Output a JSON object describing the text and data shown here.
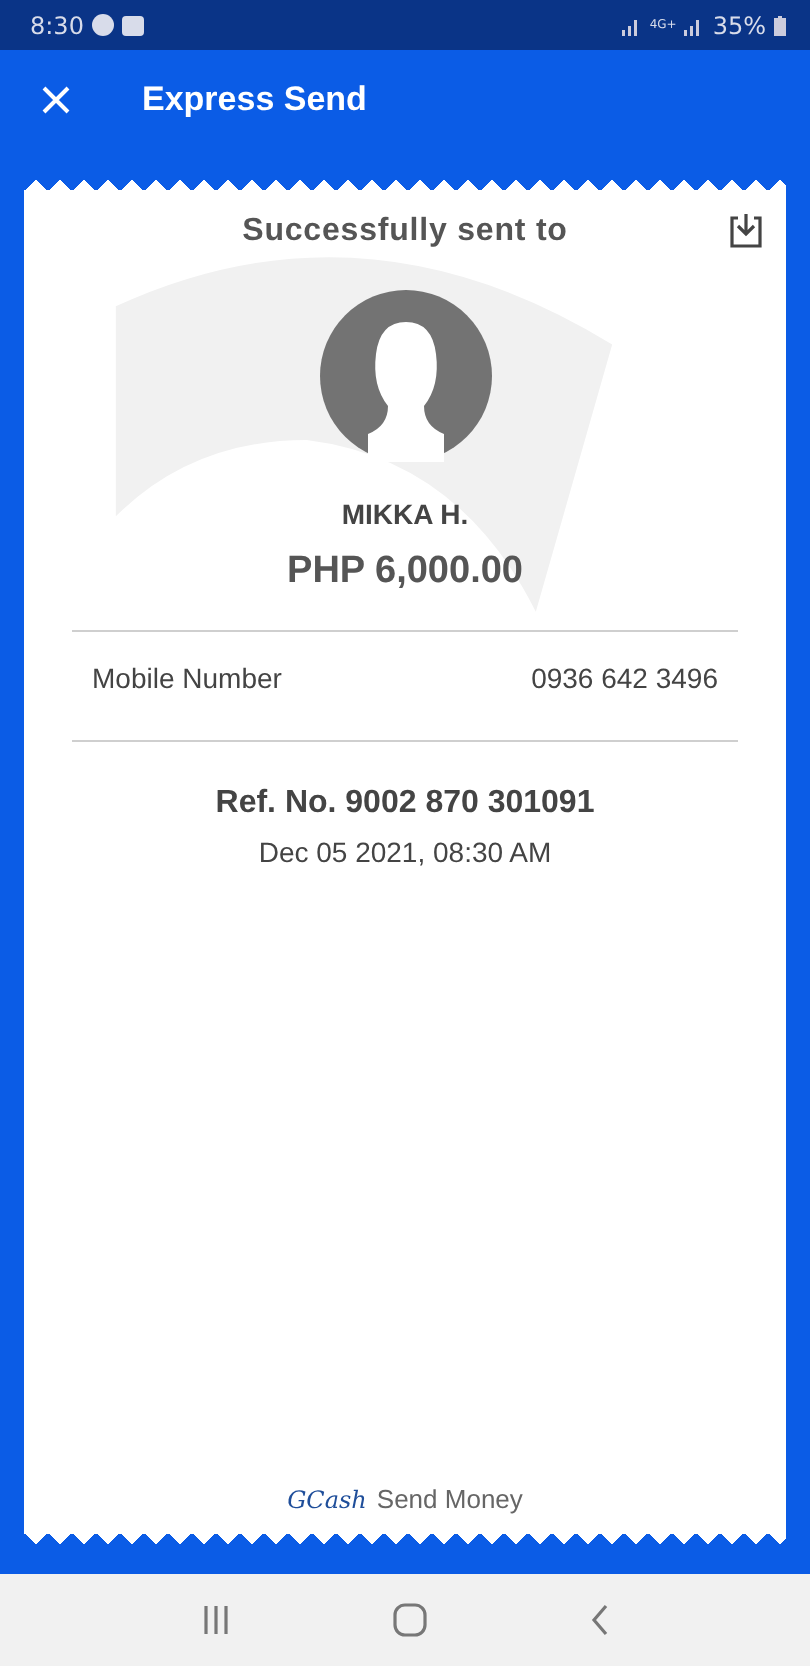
{
  "status_bar": {
    "time": "8:30",
    "network": "4G+",
    "battery": "35%"
  },
  "app_bar": {
    "title": "Express Send"
  },
  "receipt": {
    "heading": "Successfully sent to",
    "recipient": "MIKKA H.",
    "amount": "PHP 6,000.00",
    "details": [
      {
        "label": "Mobile Number",
        "value": "0936 642 3496"
      }
    ],
    "reference": "Ref. No. 9002 870 301091",
    "date": "Dec 05 2021, 08:30 AM",
    "footer_brand": "GCash",
    "footer_text": "Send Money"
  }
}
